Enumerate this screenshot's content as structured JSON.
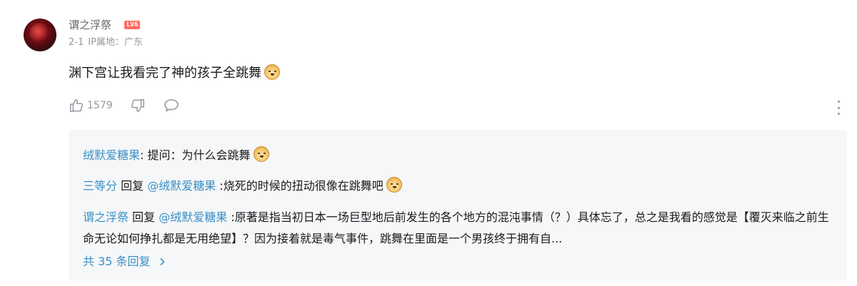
{
  "comment": {
    "username": "谓之浮祭",
    "level_badge": "LV6",
    "date": "2-1",
    "ip_location": "IP属地：广东",
    "text": "渊下宫让我看完了神的孩子全跳舞",
    "like_count": "1579",
    "emoji": "doge-emoji"
  },
  "replies": [
    {
      "author": "绒默爱糖果",
      "separator": ": ",
      "text": "提问：为什么会跳舞",
      "emoji": "doge-emoji"
    },
    {
      "author": "三等分",
      "reply_word": " 回复 ",
      "reply_to": "@绒默爱糖果",
      "separator": " :",
      "text": "烧死的时候的扭动很像在跳舞吧",
      "emoji": "doge-emoji"
    },
    {
      "author": "谓之浮祭",
      "reply_word": " 回复 ",
      "reply_to": "@绒默爱糖果",
      "separator": " :",
      "text": "原著是指当初日本一场巨型地后前发生的各个地方的混沌事情（？）具体忘了，总之是我看的感觉是【覆灭来临之前生命无论如何挣扎都是无用绝望】？因为接着就是毒气事件，跳舞在里面是一个男孩终于拥有自..."
    }
  ],
  "view_all_replies": "共 35 条回复",
  "colors": {
    "link_blue": "#3a8fc7",
    "meta_gray": "#9499a0",
    "level_badge_bg": "#ff6b5f",
    "reply_box_bg": "#f6f7f8"
  }
}
